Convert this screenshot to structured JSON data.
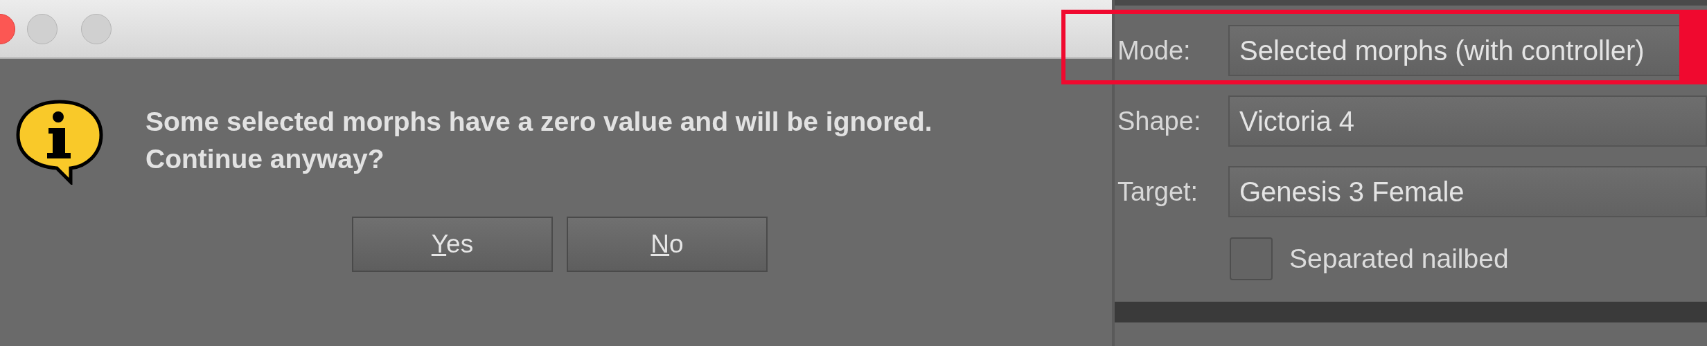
{
  "dialog": {
    "message": "Some selected morphs have a zero value and will be ignored. Continue anyway?",
    "buttons": [
      {
        "label": "Yes"
      },
      {
        "label": "No"
      }
    ]
  },
  "panel": {
    "fields": [
      {
        "kind": "dropdown",
        "label": "Mode:",
        "value": "Selected morphs (with controller)",
        "highlighted": true
      },
      {
        "kind": "dropdown",
        "label": "Shape:",
        "value": "Victoria 4",
        "highlighted": false
      },
      {
        "kind": "dropdown",
        "label": "Target:",
        "value": "Genesis 3 Female",
        "highlighted": false
      },
      {
        "kind": "checkbox",
        "label": "Separated nailbed",
        "checked": false
      }
    ]
  }
}
